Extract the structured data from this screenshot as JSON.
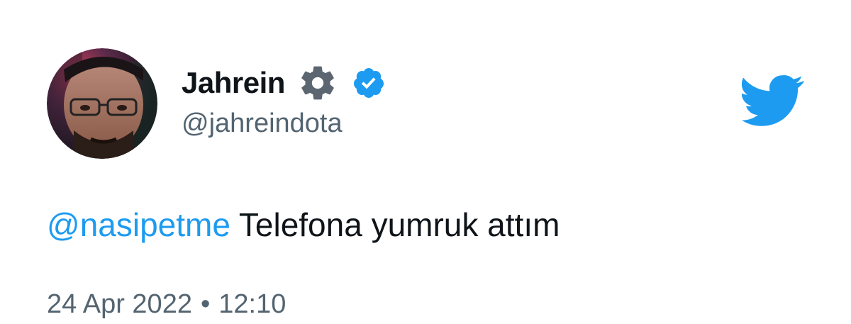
{
  "author": {
    "display_name": "Jahrein",
    "handle": "@jahreindota",
    "verified": true,
    "automated_badge_icon": "gear-icon",
    "avatar_icon": "user-avatar-photo"
  },
  "tweet": {
    "mention": "@nasipetme",
    "text": "Telefona yumruk attım",
    "date": "24 Apr 2022",
    "separator": "•",
    "time": "12:10"
  },
  "brand": {
    "icon": "twitter-bird-icon",
    "color": "#1d9bf0"
  },
  "colors": {
    "text_primary": "#0f1419",
    "text_secondary": "#536471",
    "link": "#1d9bf0",
    "verified": "#1d9bf0",
    "gear": "#5b6670"
  }
}
